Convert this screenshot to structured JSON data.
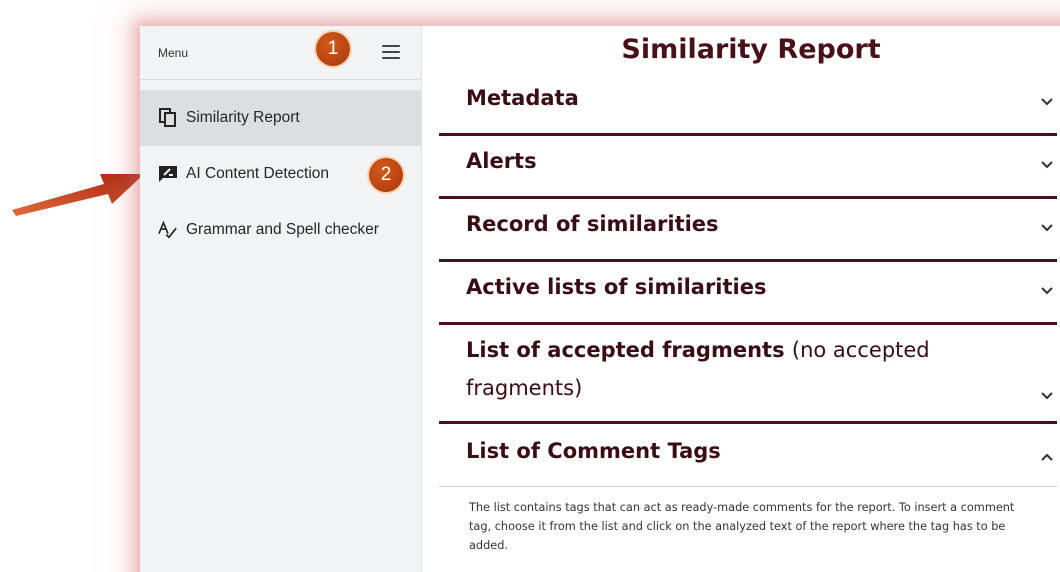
{
  "sidebar": {
    "menu_label": "Menu",
    "items": [
      {
        "label": "Similarity Report",
        "icon": "copy-icon",
        "active": true
      },
      {
        "label": "AI Content Detection",
        "icon": "ai-comment-icon",
        "active": false
      },
      {
        "label": "Grammar and Spell checker",
        "icon": "spellcheck-icon",
        "active": false
      }
    ]
  },
  "badges": {
    "one": "1",
    "two": "2"
  },
  "main": {
    "title": "Similarity Report",
    "sections": [
      {
        "title": "Metadata",
        "expanded": false
      },
      {
        "title": "Alerts",
        "expanded": false
      },
      {
        "title": "Record of similarities",
        "expanded": false
      },
      {
        "title": "Active lists of similarities",
        "expanded": false
      },
      {
        "title": "List of accepted fragments",
        "title_suffix": "(no accepted",
        "title_line2": "fragments)",
        "expanded": false
      },
      {
        "title": "List of Comment Tags",
        "expanded": true,
        "description": "The list contains tags that can act as ready-made comments for the report. To insert a comment tag, choose it from the list and click on the analyzed text of the report where the tag has to be added."
      }
    ]
  },
  "colors": {
    "accent": "#4a1018",
    "badge": "#c04a14",
    "arrow": "#c0391b"
  }
}
